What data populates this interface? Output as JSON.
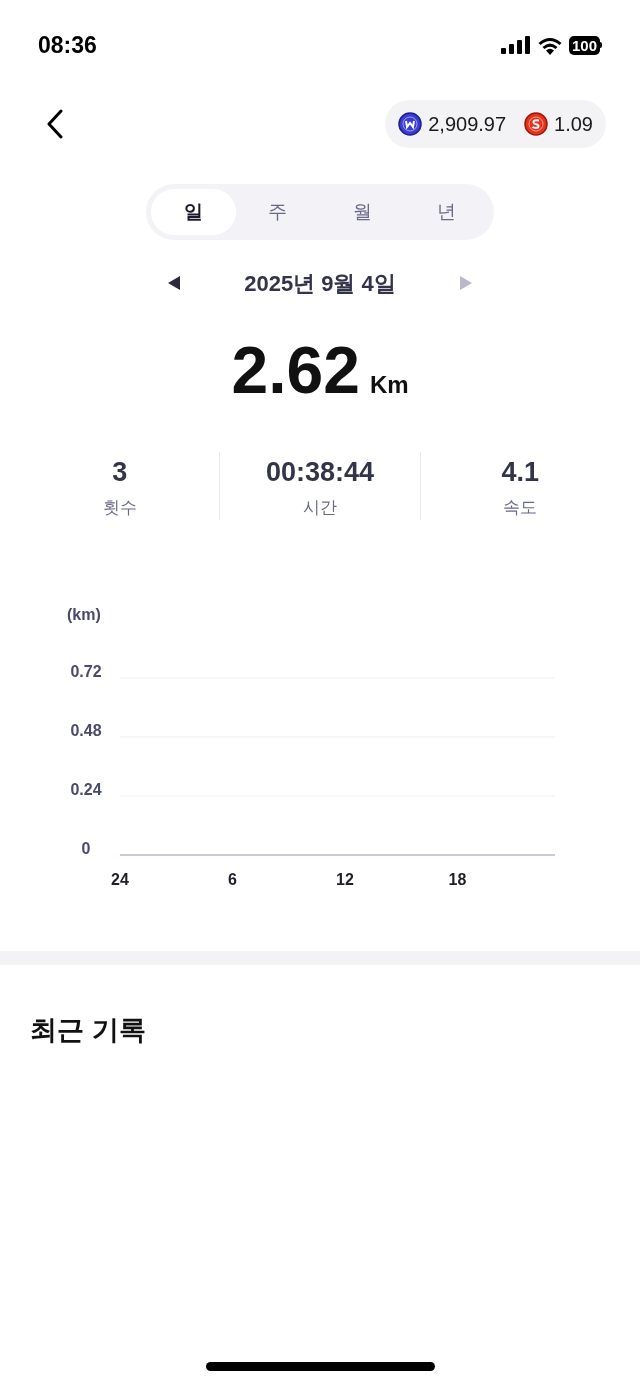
{
  "status_bar": {
    "time": "08:36",
    "battery": "100"
  },
  "header": {
    "balances": [
      {
        "kind": "w",
        "value": "2,909.97"
      },
      {
        "kind": "s",
        "value": "1.09"
      }
    ]
  },
  "tabs": [
    {
      "label": "일",
      "selected": true
    },
    {
      "label": "주",
      "selected": false
    },
    {
      "label": "월",
      "selected": false
    },
    {
      "label": "년",
      "selected": false
    }
  ],
  "date_nav": {
    "date": "2025년 9월 4일",
    "prev_disabled": false,
    "next_disabled": true
  },
  "total": {
    "value": "2.62",
    "unit": "Km"
  },
  "stats": [
    {
      "value": "3",
      "label": "횟수"
    },
    {
      "value": "00:38:44",
      "label": "시간"
    },
    {
      "value": "4.1",
      "label": "속도"
    }
  ],
  "chart": {
    "chart_data": {
      "type": "bar",
      "ylabel": "(km)",
      "ylim": [
        0,
        0.72
      ],
      "yticks": [
        {
          "value": 0,
          "label": "0"
        },
        {
          "value": 0.24,
          "label": "0.24"
        },
        {
          "value": 0.48,
          "label": "0.48"
        },
        {
          "value": 0.72,
          "label": "0.72"
        }
      ],
      "categories": [
        "24",
        "6",
        "12",
        "18"
      ]
    }
  },
  "recent": {
    "title": "최근 기록"
  }
}
